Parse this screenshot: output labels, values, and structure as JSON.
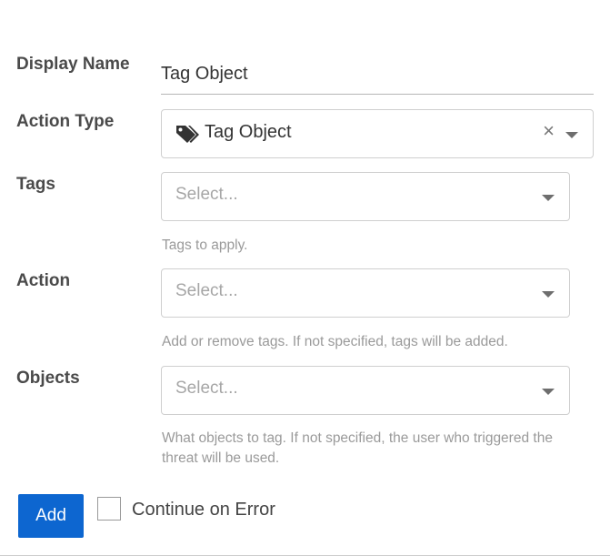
{
  "form": {
    "display_name": {
      "label": "Display Name",
      "value": "Tag Object"
    },
    "action_type": {
      "label": "Action Type",
      "value": "Tag Object",
      "icon": "tag-icon"
    },
    "tags": {
      "label": "Tags",
      "placeholder": "Select...",
      "help": "Tags to apply."
    },
    "action": {
      "label": "Action",
      "placeholder": "Select...",
      "help": "Add or remove tags. If not specified, tags will be added."
    },
    "objects": {
      "label": "Objects",
      "placeholder": "Select...",
      "help": "What objects to tag. If not specified, the user who triggered the threat will be used."
    }
  },
  "footer": {
    "add_label": "Add",
    "add_color": "#0d66d0",
    "continue_on_error_label": "Continue on Error",
    "continue_on_error_checked": false
  }
}
